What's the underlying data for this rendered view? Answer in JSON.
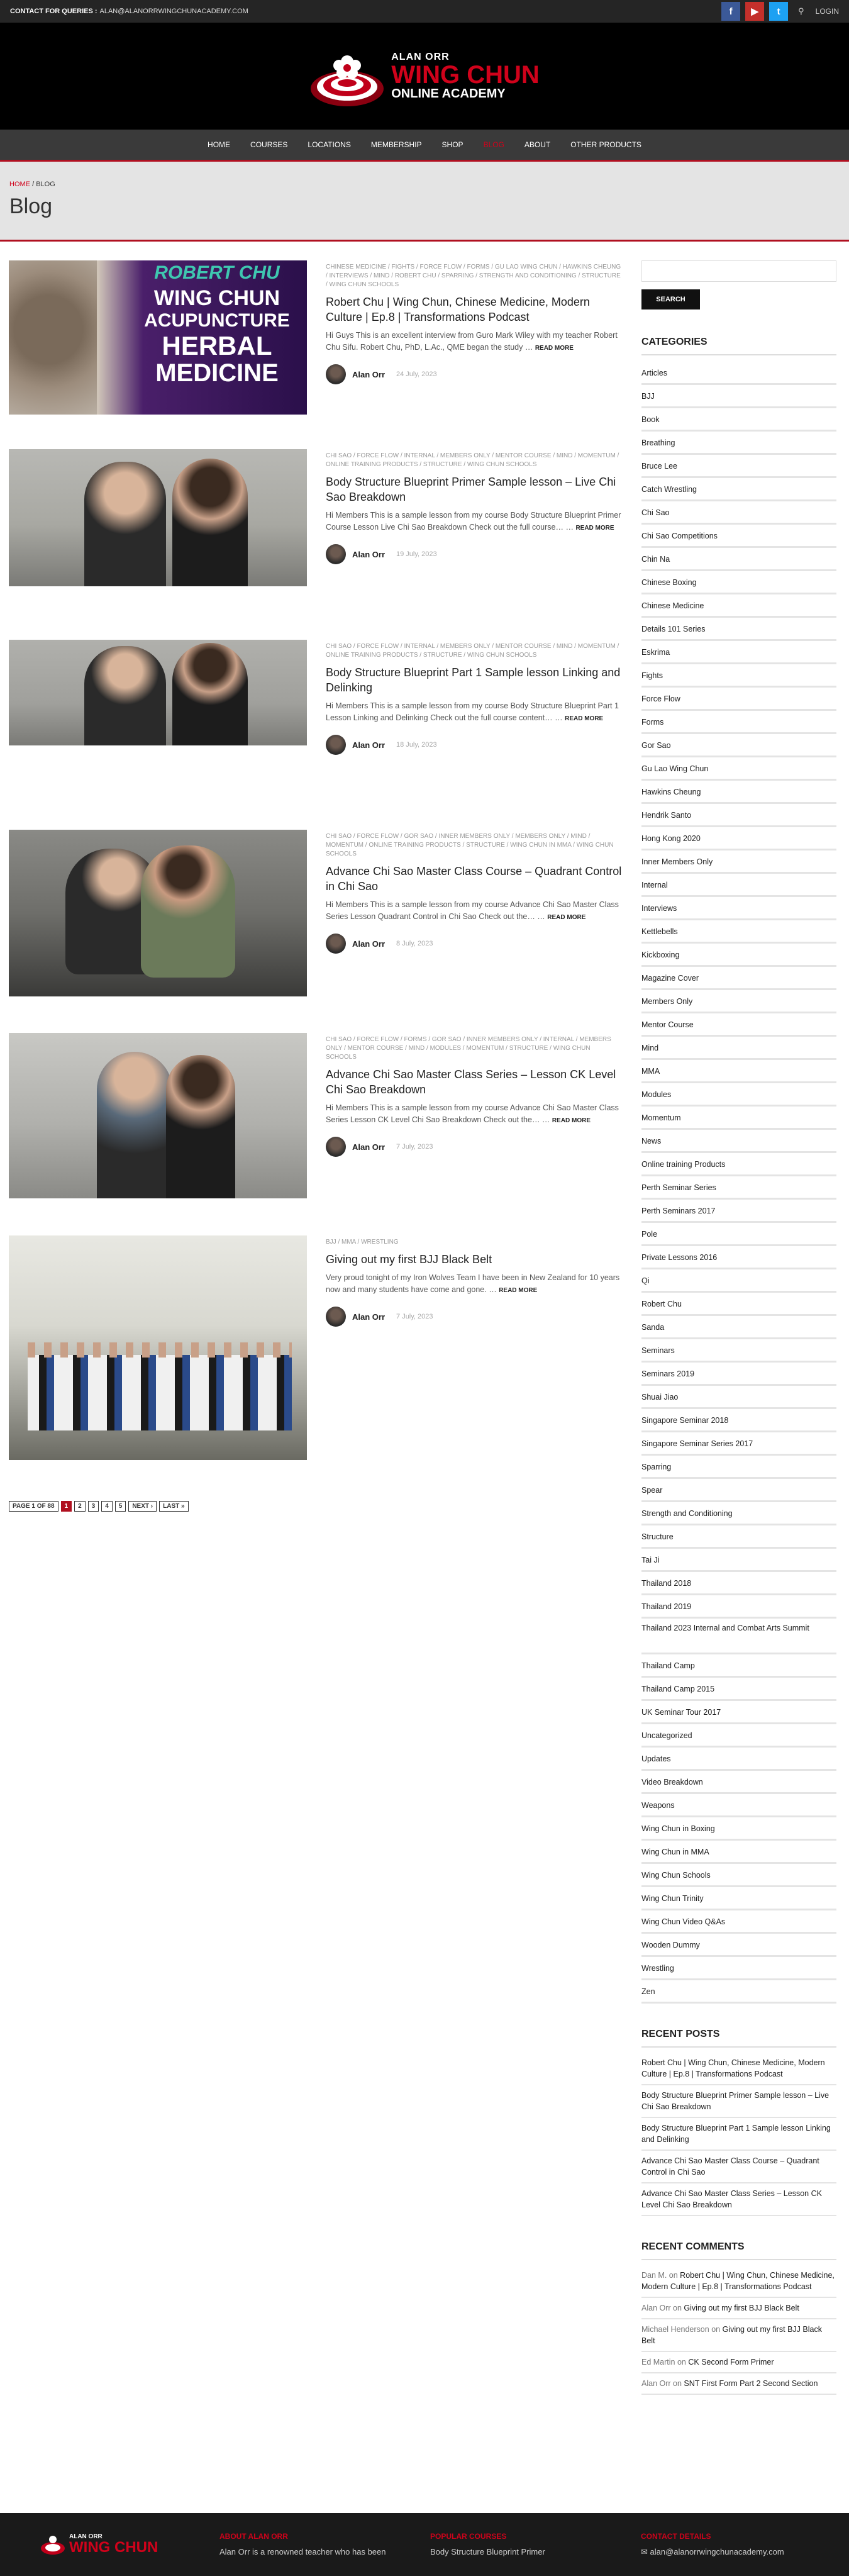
{
  "topbar": {
    "contact_label": "CONTACT FOR QUERIES :",
    "contact_email": "ALAN@ALANORRWINGCHUNACADEMY.COM",
    "login": "LOGIN"
  },
  "logo": {
    "line1": "ALAN ORR",
    "line2": "WING CHUN",
    "line3": "ONLINE ACADEMY"
  },
  "nav": [
    "HOME",
    "COURSES",
    "LOCATIONS",
    "MEMBERSHIP",
    "SHOP",
    "BLOG",
    "ABOUT",
    "OTHER PRODUCTS"
  ],
  "breadcrumb": {
    "home": "HOME",
    "sep": "/",
    "current": "BLOG"
  },
  "page_title": "Blog",
  "posts": [
    {
      "cats": "CHINESE MEDICINE / FIGHTS / FORCE FLOW / FORMS / GU LAO WING CHUN / HAWKINS CHEUNG / INTERVIEWS / MIND / ROBERT CHU / SPARRING / STRENGTH AND CONDITIONING / STRUCTURE / WING CHUN SCHOOLS",
      "title": "Robert Chu | Wing Chun, Chinese Medicine, Modern Culture | Ep.8 | Transformations Podcast",
      "excerpt": "Hi Guys This is an excellent interview from Guro Mark Wiley with my teacher Robert Chu Sifu. Robert Chu, PhD, L.Ac., QME began the study …",
      "more": "READ MORE",
      "author": "Alan Orr",
      "date": "24 July, 2023",
      "thumb_text1": "ROBERT CHU",
      "thumb_text2": "WING CHUN",
      "thumb_text3": "ACUPUNCTURE",
      "thumb_text4": "HERBAL",
      "thumb_text5": "MEDICINE"
    },
    {
      "cats": "CHI SAO / FORCE FLOW / INTERNAL / MEMBERS ONLY / MENTOR COURSE / MIND / MOMENTUM / ONLINE TRAINING PRODUCTS / STRUCTURE / WING CHUN SCHOOLS",
      "title": "Body Structure Blueprint Primer Sample lesson – Live Chi Sao Breakdown",
      "excerpt": "Hi Members This is a sample lesson from my course Body Structure Blueprint Primer Course Lesson Live Chi Sao Breakdown Check out the full course… …",
      "more": "READ MORE",
      "author": "Alan Orr",
      "date": "19 July, 2023"
    },
    {
      "cats": "CHI SAO / FORCE FLOW / INTERNAL / MEMBERS ONLY / MENTOR COURSE / MIND / MOMENTUM / ONLINE TRAINING PRODUCTS / STRUCTURE / WING CHUN SCHOOLS",
      "title": "Body Structure Blueprint Part 1 Sample lesson Linking and Delinking",
      "excerpt": "Hi Members This is a sample lesson from my course Body Structure Blueprint Part 1 Lesson Linking and Delinking Check out the full course content… …",
      "more": "READ MORE",
      "author": "Alan Orr",
      "date": "18 July, 2023"
    },
    {
      "cats": "CHI SAO / FORCE FLOW / GOR SAO / INNER MEMBERS ONLY / MEMBERS ONLY / MIND / MOMENTUM / ONLINE TRAINING PRODUCTS / STRUCTURE / WING CHUN IN MMA / WING CHUN SCHOOLS",
      "title": "Advance Chi Sao Master Class Course – Quadrant Control in Chi Sao",
      "excerpt": "Hi Members This is a sample lesson from my course Advance Chi Sao Master Class Series Lesson Quadrant Control in Chi Sao Check out the… …",
      "more": "READ MORE",
      "author": "Alan Orr",
      "date": "8 July, 2023"
    },
    {
      "cats": "CHI SAO / FORCE FLOW / FORMS / GOR SAO / INNER MEMBERS ONLY / INTERNAL / MEMBERS ONLY / MENTOR COURSE / MIND / MODULES / MOMENTUM / STRUCTURE / WING CHUN SCHOOLS",
      "title": "Advance Chi Sao Master Class Series – Lesson CK Level Chi Sao Breakdown",
      "excerpt": "Hi Members This is a sample lesson from my course Advance Chi Sao Master Class Series Lesson CK Level Chi Sao Breakdown Check out the… …",
      "more": "READ MORE",
      "author": "Alan Orr",
      "date": "7 July, 2023"
    },
    {
      "cats": "BJJ / MMA / WRESTLING",
      "title": "Giving out my first BJJ Black Belt",
      "excerpt": "Very proud tonight of my Iron Wolves Team I have been in New Zealand for 10 years now and many students have come and gone. …",
      "more": "READ MORE",
      "author": "Alan Orr",
      "date": "7 July, 2023"
    }
  ],
  "pager": [
    "PAGE 1 OF 88",
    "1",
    "2",
    "3",
    "4",
    "5",
    "NEXT ›",
    "LAST »"
  ],
  "sidebar": {
    "search_button": "SEARCH",
    "categories_title": "CATEGORIES",
    "categories": [
      "Articles",
      "BJJ",
      "Book",
      "Breathing",
      "Bruce Lee",
      "Catch Wrestling",
      "Chi Sao",
      "Chi Sao Competitions",
      "Chin Na",
      "Chinese Boxing",
      "Chinese Medicine",
      "Details 101 Series",
      "Eskrima",
      "Fights",
      "Force Flow",
      "Forms",
      "Gor Sao",
      "Gu Lao Wing Chun",
      "Hawkins Cheung",
      "Hendrik Santo",
      "Hong Kong 2020",
      "Inner Members Only",
      "Internal",
      "Interviews",
      "Kettlebells",
      "Kickboxing",
      "Magazine Cover",
      "Members Only",
      "Mentor Course",
      "Mind",
      "MMA",
      "Modules",
      "Momentum",
      "News",
      "Online training Products",
      "Perth Seminar Series",
      "Perth Seminars 2017",
      "Pole",
      "Private Lessons 2016",
      "Qi",
      "Robert Chu",
      "Sanda",
      "Seminars",
      "Seminars 2019",
      "Shuai Jiao",
      "Singapore Seminar 2018",
      "Singapore Seminar Series 2017",
      "Sparring",
      "Spear",
      "Strength and Conditioning",
      "Structure",
      "Tai Ji",
      "Thailand 2018",
      "Thailand 2019",
      "Thailand 2023 Internal and Combat Arts Summit",
      "Thailand Camp",
      "Thailand Camp 2015",
      "UK Seminar Tour 2017",
      "Uncategorized",
      "Updates",
      "Video Breakdown",
      "Weapons",
      "Wing Chun in Boxing",
      "Wing Chun in MMA",
      "Wing Chun Schools",
      "Wing Chun Trinity",
      "Wing Chun Video Q&As",
      "Wooden Dummy",
      "Wrestling",
      "Zen"
    ],
    "recent_posts_title": "RECENT POSTS",
    "recent_posts": [
      "Robert Chu | Wing Chun, Chinese Medicine, Modern Culture | Ep.8 | Transformations Podcast",
      "Body Structure Blueprint Primer Sample lesson – Live Chi Sao Breakdown",
      "Body Structure Blueprint Part 1 Sample lesson Linking and Delinking",
      "Advance Chi Sao Master Class Course – Quadrant Control in Chi Sao",
      "Advance Chi Sao Master Class Series – Lesson CK Level Chi Sao Breakdown"
    ],
    "recent_comments_title": "RECENT COMMENTS",
    "recent_comments": [
      {
        "author": "Dan M.",
        "on": "on",
        "post": "Robert Chu | Wing Chun, Chinese Medicine, Modern Culture | Ep.8 | Transformations Podcast"
      },
      {
        "author": "Alan Orr",
        "on": "on",
        "post": "Giving out my first BJJ Black Belt"
      },
      {
        "author": "Michael Henderson",
        "on": "on",
        "post": "Giving out my first BJJ Black Belt"
      },
      {
        "author": "Ed Martin",
        "on": "on",
        "post": "CK Second Form Primer"
      },
      {
        "author": "Alan Orr",
        "on": "on",
        "post": "SNT First Form Part 2 Second Section"
      }
    ]
  },
  "footer": {
    "about_title": "ABOUT ALAN ORR",
    "about_text": "Alan Orr is a renowned teacher who has been",
    "popular_title": "POPULAR COURSES",
    "popular_item": "Body Structure Blueprint Primer",
    "contact_title": "CONTACT DETAILS",
    "contact_email": "alan@alanorrwingchunacademy.com"
  }
}
